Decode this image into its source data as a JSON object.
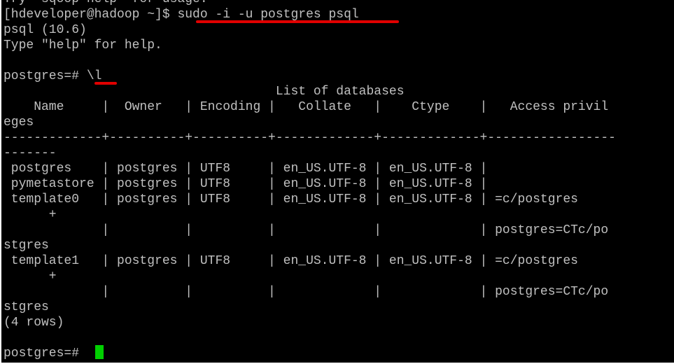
{
  "terminal": {
    "lines": [
      "Try \"sqoop help\" for usage.",
      "[hdeveloper@hadoop ~]$ sudo -i -u postgres psql",
      "psql (10.6)",
      "Type \"help\" for help.",
      "",
      "postgres=# \\l",
      "                                    List of databases",
      "    Name     |  Owner   | Encoding |   Collate   |    Ctype    |   Access privil",
      "eges",
      "-------------+----------+----------+-------------+-------------+-----------------",
      "-------",
      " postgres    | postgres | UTF8     | en_US.UTF-8 | en_US.UTF-8 |",
      " pymetastore | postgres | UTF8     | en_US.UTF-8 | en_US.UTF-8 |",
      " template0   | postgres | UTF8     | en_US.UTF-8 | en_US.UTF-8 | =c/postgres",
      "      +",
      "             |          |          |             |             | postgres=CTc/po",
      "stgres",
      " template1   | postgres | UTF8     | en_US.UTF-8 | en_US.UTF-8 | =c/postgres",
      "      +",
      "             |          |          |             |             | postgres=CTc/po",
      "stgres",
      "(4 rows)",
      "",
      "postgres=# "
    ],
    "foreground": "#c0c0c0",
    "background": "#000000",
    "cursor_color": "#00d000",
    "highlight_color": "#e00000"
  }
}
